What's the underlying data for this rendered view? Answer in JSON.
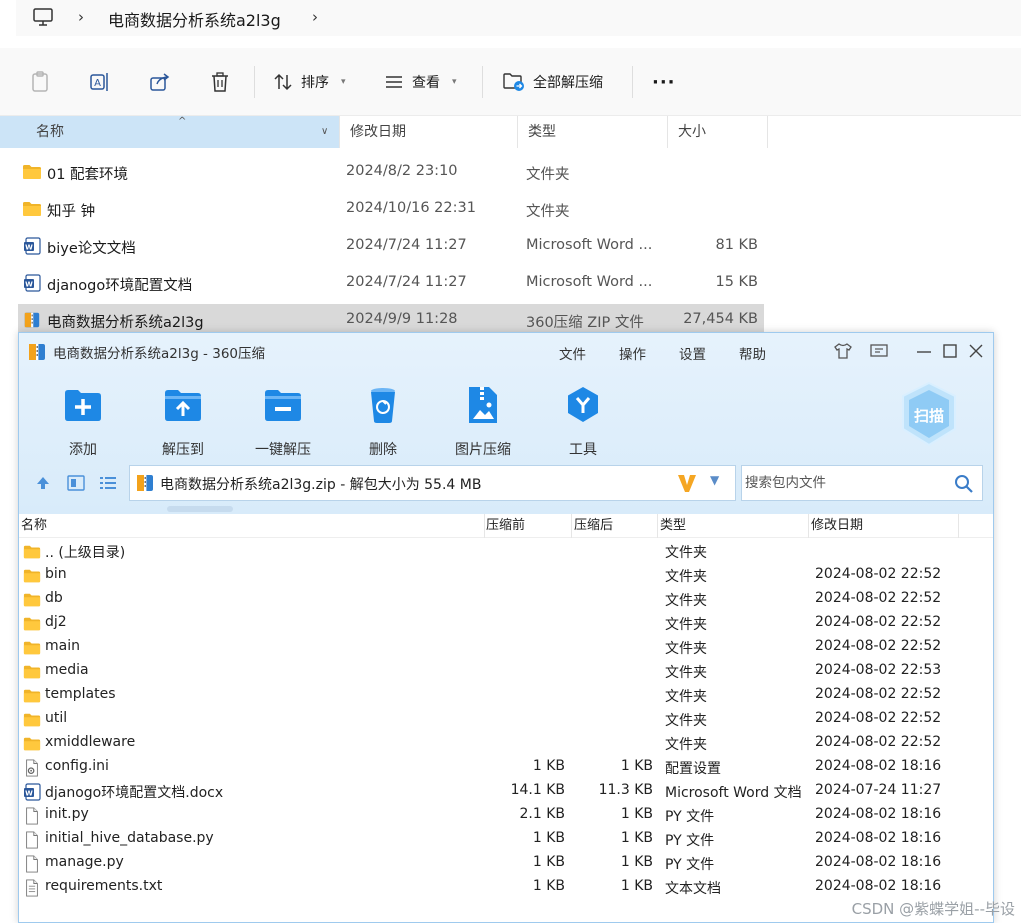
{
  "explorer": {
    "breadcrumb": "电商数据分析系统a2l3g",
    "toolbar": {
      "sort": "排序",
      "view": "查看",
      "extract_all": "全部解压缩",
      "more": "···"
    },
    "columns": {
      "name": "名称",
      "date": "修改日期",
      "type": "类型",
      "size": "大小"
    },
    "rows": [
      {
        "name": "01 配套环境",
        "date": "2024/8/2 23:10",
        "type": "文件夹",
        "size": "",
        "icon": "folder-icon"
      },
      {
        "name": "知乎 钟",
        "date": "2024/10/16 22:31",
        "type": "文件夹",
        "size": "",
        "icon": "folder-icon"
      },
      {
        "name": "biye论文文档",
        "date": "2024/7/24 11:27",
        "type": "Microsoft Word ...",
        "size": "81 KB",
        "icon": "word-icon"
      },
      {
        "name": "djanogo环境配置文档",
        "date": "2024/7/24 11:27",
        "type": "Microsoft Word ...",
        "size": "15 KB",
        "icon": "word-icon"
      },
      {
        "name": "电商数据分析系统a2l3g",
        "date": "2024/9/9 11:28",
        "type": "360压缩 ZIP 文件",
        "size": "27,454 KB",
        "icon": "zip-icon",
        "selected": true
      }
    ]
  },
  "zip": {
    "title": "电商数据分析系统a2l3g - 360压缩",
    "menu": [
      "文件",
      "操作",
      "设置",
      "帮助"
    ],
    "tools": [
      {
        "label": "添加",
        "icon": "add-icon"
      },
      {
        "label": "解压到",
        "icon": "extract-to-icon"
      },
      {
        "label": "一键解压",
        "icon": "one-click-extract-icon"
      },
      {
        "label": "删除",
        "icon": "delete-icon"
      },
      {
        "label": "图片压缩",
        "icon": "image-compress-icon"
      },
      {
        "label": "工具",
        "icon": "tools-icon"
      }
    ],
    "scan_label": "扫描",
    "path": "电商数据分析系统a2l3g.zip - 解包大小为 55.4 MB",
    "search_placeholder": "搜索包内文件",
    "columns": {
      "name": "名称",
      "before": "压缩前",
      "after": "压缩后",
      "type": "类型",
      "date": "修改日期"
    },
    "rows": [
      {
        "name": ".. (上级目录)",
        "before": "",
        "after": "",
        "type": "文件夹",
        "date": "",
        "icon": "folder-icon"
      },
      {
        "name": "bin",
        "before": "",
        "after": "",
        "type": "文件夹",
        "date": "2024-08-02 22:52",
        "icon": "folder-icon"
      },
      {
        "name": "db",
        "before": "",
        "after": "",
        "type": "文件夹",
        "date": "2024-08-02 22:52",
        "icon": "folder-icon"
      },
      {
        "name": "dj2",
        "before": "",
        "after": "",
        "type": "文件夹",
        "date": "2024-08-02 22:52",
        "icon": "folder-icon"
      },
      {
        "name": "main",
        "before": "",
        "after": "",
        "type": "文件夹",
        "date": "2024-08-02 22:52",
        "icon": "folder-icon"
      },
      {
        "name": "media",
        "before": "",
        "after": "",
        "type": "文件夹",
        "date": "2024-08-02 22:53",
        "icon": "folder-icon"
      },
      {
        "name": "templates",
        "before": "",
        "after": "",
        "type": "文件夹",
        "date": "2024-08-02 22:52",
        "icon": "folder-icon"
      },
      {
        "name": "util",
        "before": "",
        "after": "",
        "type": "文件夹",
        "date": "2024-08-02 22:52",
        "icon": "folder-icon"
      },
      {
        "name": "xmiddleware",
        "before": "",
        "after": "",
        "type": "文件夹",
        "date": "2024-08-02 22:52",
        "icon": "folder-icon"
      },
      {
        "name": "config.ini",
        "before": "1 KB",
        "after": "1 KB",
        "type": "配置设置",
        "date": "2024-08-02 18:16",
        "icon": "config-file-icon"
      },
      {
        "name": "djanogo环境配置文档.docx",
        "before": "14.1 KB",
        "after": "11.3 KB",
        "type": "Microsoft Word 文档",
        "date": "2024-07-24 11:27",
        "icon": "word-icon"
      },
      {
        "name": "init.py",
        "before": "2.1 KB",
        "after": "1 KB",
        "type": "PY 文件",
        "date": "2024-08-02 18:16",
        "icon": "file-icon"
      },
      {
        "name": "initial_hive_database.py",
        "before": "1 KB",
        "after": "1 KB",
        "type": "PY 文件",
        "date": "2024-08-02 18:16",
        "icon": "file-icon"
      },
      {
        "name": "manage.py",
        "before": "1 KB",
        "after": "1 KB",
        "type": "PY 文件",
        "date": "2024-08-02 18:16",
        "icon": "file-icon"
      },
      {
        "name": "requirements.txt",
        "before": "1 KB",
        "after": "1 KB",
        "type": "文本文档",
        "date": "2024-08-02 18:16",
        "icon": "text-file-icon"
      }
    ]
  },
  "watermark": "CSDN @紫蝶学姐--毕设",
  "colors": {
    "folder": "#ffc83d",
    "accent": "#1e88e5",
    "selected_row": "#d9d9d9",
    "header_blue": "#cce4f7",
    "zip_header": "#dcedfb"
  }
}
